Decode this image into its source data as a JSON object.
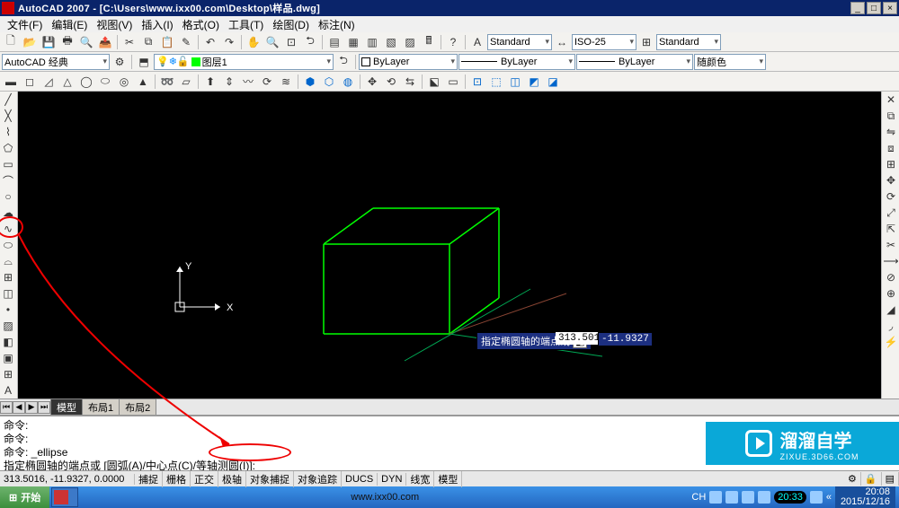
{
  "titlebar": {
    "app": "AutoCAD 2007",
    "file": "[C:\\Users\\www.ixx00.com\\Desktop\\样品.dwg]"
  },
  "menu": {
    "file": "文件(F)",
    "edit": "编辑(E)",
    "view": "视图(V)",
    "insert": "插入(I)",
    "format": "格式(O)",
    "tools": "工具(T)",
    "draw": "绘图(D)",
    "dimension": "标注(N)"
  },
  "topcombo1": {
    "style1": "Standard",
    "style2": "ISO-25",
    "style3": "Standard"
  },
  "workspace_combo": "AutoCAD 经典",
  "layer_combo": "图层1",
  "props": {
    "bylayer1": "ByLayer",
    "bylayer2": "ByLayer",
    "bylayer3": "ByLayer",
    "color": "随颜色"
  },
  "tabs": {
    "model": "模型",
    "layout1": "布局1",
    "layout2": "布局2"
  },
  "cmd": {
    "l1": "命令:",
    "l2": "命令:",
    "l3": "命令: _ellipse",
    "l4": "指定椭圆轴的端点或 [圆弧(A)/中心点(C)/等轴测圆(I)]:"
  },
  "status": {
    "coord": "313.5016, -11.9327, 0.0000",
    "snap": "捕捉",
    "grid": "栅格",
    "ortho": "正交",
    "polar": "极轴",
    "osnap": "对象捕捉",
    "otrack": "对象追踪",
    "ducs": "DUCS",
    "dyn": "DYN",
    "lwt": "线宽",
    "model": "模型"
  },
  "tooltip": {
    "text": "指定椭圆轴的端点或",
    "x": "313.5016",
    "y": "-11.9327"
  },
  "taskbar": {
    "start": "开始",
    "url": "www.ixx00.com",
    "ime": "CH",
    "time": "20:08",
    "date": "2015/12/16"
  },
  "tray_time_box": "20:33",
  "watermark": {
    "brand": "溜溜自学",
    "url": "ZIXUE.3D66.COM"
  },
  "axis_labels": {
    "x": "X",
    "y": "Y"
  }
}
